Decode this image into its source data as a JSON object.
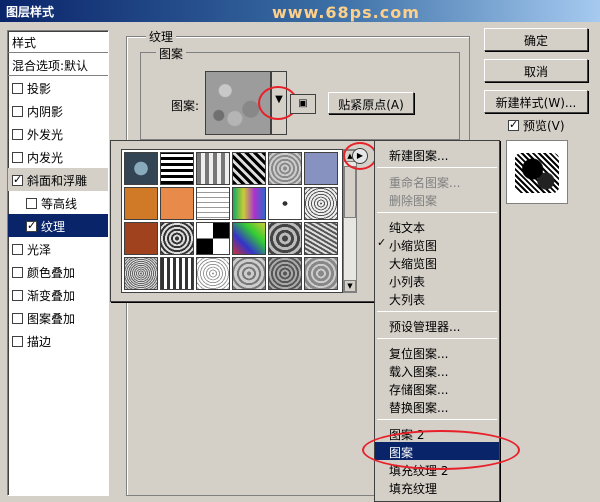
{
  "window": {
    "title": "图层样式",
    "watermark": "www.68ps.com"
  },
  "sidebar": {
    "header": "样式",
    "blend": "混合选项:默认",
    "items": [
      {
        "label": "投影",
        "checked": false
      },
      {
        "label": "内阴影",
        "checked": false
      },
      {
        "label": "外发光",
        "checked": false
      },
      {
        "label": "内发光",
        "checked": false
      },
      {
        "label": "斜面和浮雕",
        "checked": true
      },
      {
        "label": "等高线",
        "checked": false
      },
      {
        "label": "纹理",
        "checked": true
      },
      {
        "label": "光泽",
        "checked": false
      },
      {
        "label": "颜色叠加",
        "checked": false
      },
      {
        "label": "渐变叠加",
        "checked": false
      },
      {
        "label": "图案叠加",
        "checked": false
      },
      {
        "label": "描边",
        "checked": false
      }
    ]
  },
  "texture": {
    "group_label": "纹理",
    "pattern_group": "图案",
    "pattern_label": "图案:",
    "snap_button": "贴紧原点(A)"
  },
  "buttons": {
    "ok": "确定",
    "cancel": "取消",
    "new_style": "新建样式(W)...",
    "preview": "预览(V)"
  },
  "menu": {
    "items": [
      {
        "label": "新建图案...",
        "state": "normal"
      },
      {
        "sep": true
      },
      {
        "label": "重命名图案...",
        "state": "disabled"
      },
      {
        "label": "删除图案",
        "state": "disabled"
      },
      {
        "sep": true
      },
      {
        "label": "纯文本",
        "state": "normal"
      },
      {
        "label": "小缩览图",
        "state": "checked"
      },
      {
        "label": "大缩览图",
        "state": "normal"
      },
      {
        "label": "小列表",
        "state": "normal"
      },
      {
        "label": "大列表",
        "state": "normal"
      },
      {
        "sep": true
      },
      {
        "label": "预设管理器...",
        "state": "normal"
      },
      {
        "sep": true
      },
      {
        "label": "复位图案...",
        "state": "normal"
      },
      {
        "label": "载入图案...",
        "state": "normal"
      },
      {
        "label": "存储图案...",
        "state": "normal"
      },
      {
        "label": "替换图案...",
        "state": "normal"
      },
      {
        "sep": true
      },
      {
        "label": "图案 2",
        "state": "normal"
      },
      {
        "label": "图案",
        "state": "highlight"
      },
      {
        "label": "填充纹理 2",
        "state": "normal"
      },
      {
        "label": "填充纹理",
        "state": "normal"
      }
    ]
  },
  "colors": {
    "selection": "#0a246a",
    "annotation": "#e8202a",
    "face": "#d4d0c8"
  }
}
